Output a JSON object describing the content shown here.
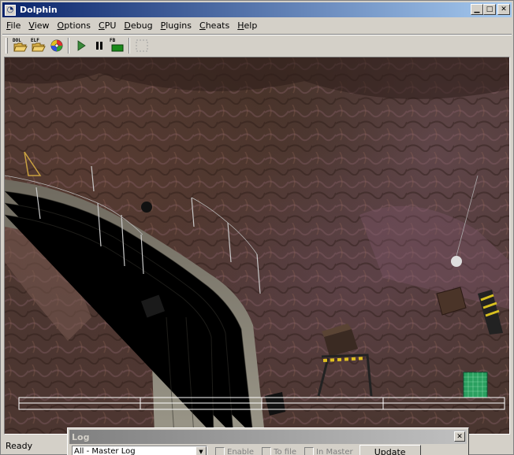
{
  "window": {
    "title": "Dolphin"
  },
  "menu": {
    "items": [
      {
        "label": "File",
        "key": "F"
      },
      {
        "label": "View",
        "key": "V"
      },
      {
        "label": "Options",
        "key": "O"
      },
      {
        "label": "CPU",
        "key": "C"
      },
      {
        "label": "Debug",
        "key": "D"
      },
      {
        "label": "Plugins",
        "key": "P"
      },
      {
        "label": "Cheats",
        "key": "C"
      },
      {
        "label": "Help",
        "key": "H"
      }
    ]
  },
  "toolbar": {
    "dol_label": "DOL",
    "elf_label": "ELF",
    "fb_label": "FB",
    "icons": [
      "open-dol-icon",
      "open-elf-icon",
      "gcm-disc-icon",
      "play-icon",
      "pause-icon",
      "framebuffer-icon",
      "fullscreen-icon"
    ]
  },
  "status": {
    "text": "Ready"
  },
  "log": {
    "title": "Log",
    "source_selected": "All - Master Log",
    "enable_label": "Enable",
    "tofile_label": "To file",
    "inmaster_label": "In Master",
    "update_label": "Update"
  },
  "colors": {
    "title_active": "#0a246a",
    "title_inactive": "#808080",
    "face": "#d4d0c8"
  }
}
